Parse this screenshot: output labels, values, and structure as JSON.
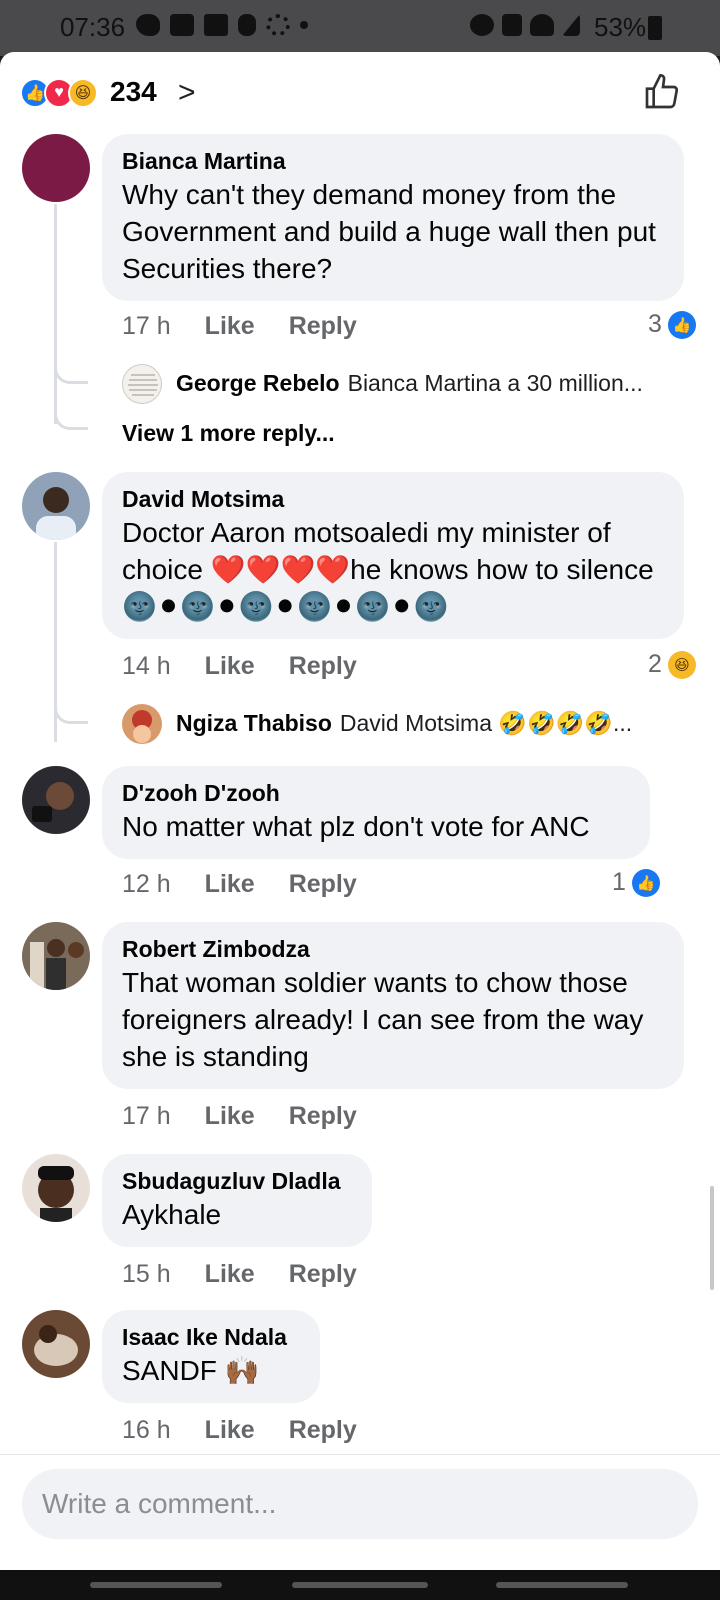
{
  "status_bar": {
    "time": "07:36",
    "battery": "53%",
    "left_icons": [
      "twitter-icon",
      "youtube-icon",
      "calendar-icon",
      "bug-icon",
      "settings-icon",
      "dot-icon"
    ],
    "right_icons": [
      "alarm-icon",
      "mute-icon",
      "wifi-icon",
      "signal-icon",
      "battery-icon"
    ]
  },
  "header": {
    "reaction_count": "234",
    "reactions": [
      "like",
      "love",
      "haha"
    ]
  },
  "comments": [
    {
      "author": "Bianca Martina",
      "text": "Why can't they demand money from the Government and build a huge wall then put Securities there?",
      "time": "17 h",
      "like_label": "Like",
      "reply_label": "Reply",
      "reaction_count": "3",
      "reaction_type": "like",
      "avatar_color": "#7a1a45",
      "reply": {
        "author": "George Rebelo",
        "text": "Bianca Martina a 30 million...",
        "avatar_text": "Life is all in one game. Just different levels. Dealing with the same folk just different devil"
      },
      "more_replies": "View 1 more reply..."
    },
    {
      "author": "David Motsima",
      "text": "Doctor Aaron motsoaledi my minister of choice ❤️❤️❤️❤️he knows how to silence 🌚⚫🌚⚫🌚⚫🌚⚫🌚⚫🌚",
      "time": "14 h",
      "like_label": "Like",
      "reply_label": "Reply",
      "reaction_count": "2",
      "reaction_type": "haha",
      "avatar_color": "#8fa2b8",
      "reply": {
        "author": "Ngiza Thabiso",
        "text": "David Motsima 🤣🤣🤣🤣..."
      }
    },
    {
      "author": "D'zooh D'zooh",
      "text": "No matter what plz don't vote for ANC",
      "time": "12 h",
      "like_label": "Like",
      "reply_label": "Reply",
      "reaction_count": "1",
      "reaction_type": "like",
      "avatar_color": "#2a2a30"
    },
    {
      "author": "Robert Zimbodza",
      "text": "That woman soldier wants to chow those foreigners already! I can see from the way she is standing",
      "time": "17 h",
      "like_label": "Like",
      "reply_label": "Reply",
      "avatar_color": "#7a6a5a"
    },
    {
      "author": "Sbudaguzluv Dladla",
      "text": "Aykhale",
      "time": "15 h",
      "like_label": "Like",
      "reply_label": "Reply",
      "avatar_color": "#3b2a22"
    },
    {
      "author": "Isaac Ike Ndala",
      "text": "SANDF 🙌🏾",
      "time": "16 h",
      "like_label": "Like",
      "reply_label": "Reply",
      "avatar_color": "#6a4a35"
    }
  ],
  "composer": {
    "placeholder": "Write a comment..."
  },
  "colors": {
    "facebook_blue": "#1877f2",
    "bubble_bg": "#f0f2f5",
    "meta_text": "#65676b"
  }
}
